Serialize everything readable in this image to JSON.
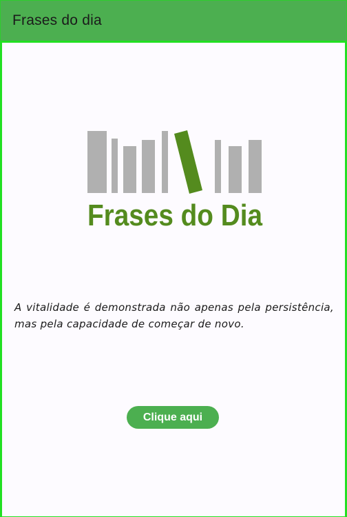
{
  "appbar": {
    "title": "Frases do dia"
  },
  "logo": {
    "text": "Frases do Dia",
    "book_color": "#b0b0b0",
    "accent_color": "#548b1e"
  },
  "quote": {
    "text": "A vitalidade é demonstrada não apenas pela persistência, mas pela capacidade de começar de novo."
  },
  "button": {
    "label": "Clique aqui"
  },
  "colors": {
    "appbar": "#4caf50",
    "button": "#4caf50",
    "border": "#22e022",
    "background": "#fdfbff"
  }
}
